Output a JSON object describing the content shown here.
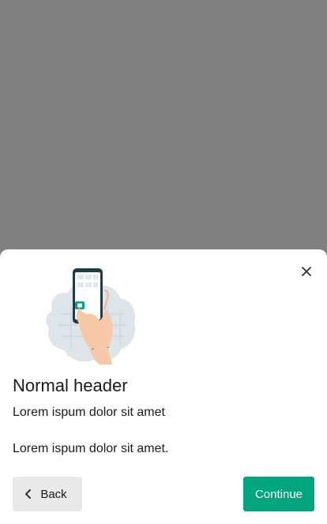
{
  "dialog": {
    "header": "Normal header",
    "subtitle": "Lorem ispum dolor sit amet",
    "body": "Lorem ispum dolor sit amet.",
    "close_icon": "close-icon",
    "illustration": "hand-holding-phone-illustration"
  },
  "actions": {
    "back_label": "Back",
    "back_icon": "chevron-left-icon",
    "continue_label": "Continue"
  },
  "colors": {
    "backdrop": "#808080",
    "accent": "#00a67e",
    "secondary_button": "#e9e9e9",
    "text": "#1a1a1a"
  }
}
